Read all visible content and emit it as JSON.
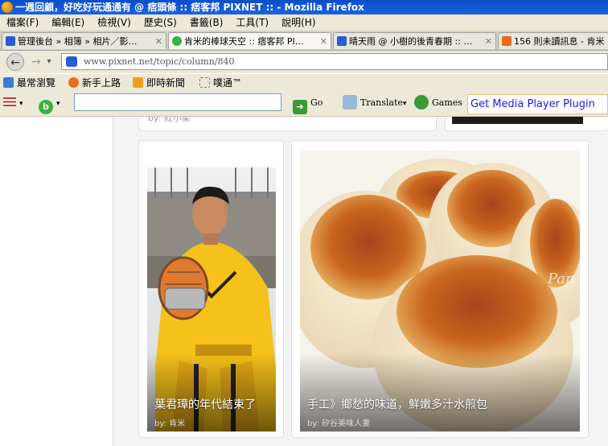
{
  "window": {
    "title": "一週回顧，好吃好玩通通有 @ 痞頭條 :: 痞客邦 PIXNET :: - Mozilla Firefox"
  },
  "menu": [
    "檔案(F)",
    "編輯(E)",
    "檢視(V)",
    "歷史(S)",
    "書籤(B)",
    "工具(T)",
    "說明(H)"
  ],
  "tabs": [
    {
      "label": "管理後台 » 相簿 » 相片／影…",
      "icon_color": "#2a5bd7"
    },
    {
      "label": "肯米的棒球天空 :: 痞客邦 PI…",
      "icon_color": "#3cb043"
    },
    {
      "label": "晴天雨 @ 小樹的後青春期 :: …",
      "icon_color": "#2a5bd7"
    },
    {
      "label": "156 則未讀訊息 - 肯米",
      "icon_color": "#e86a1a"
    }
  ],
  "nav": {
    "url": "www.pixnet.net/topic/column/840"
  },
  "bookmarks": [
    "最常瀏覽",
    "新手上路",
    "即時新聞",
    "噗通™"
  ],
  "toolbar": {
    "search_value": "",
    "go_label": "Go",
    "translate_label": "Translate",
    "games_label": "Games"
  },
  "plugin_bar": {
    "label": "Get Media Player Plugin"
  },
  "articles": {
    "top_left_by": "by: 紅小柔",
    "left_title": "葉君璋的年代結束了",
    "left_by": "by: 肯米",
    "right_title": "手工》鄉愁的味道，鮮嫩多汁水煎包",
    "right_by": "by: 矽谷美味人妻",
    "right_watermark": "Pan"
  }
}
